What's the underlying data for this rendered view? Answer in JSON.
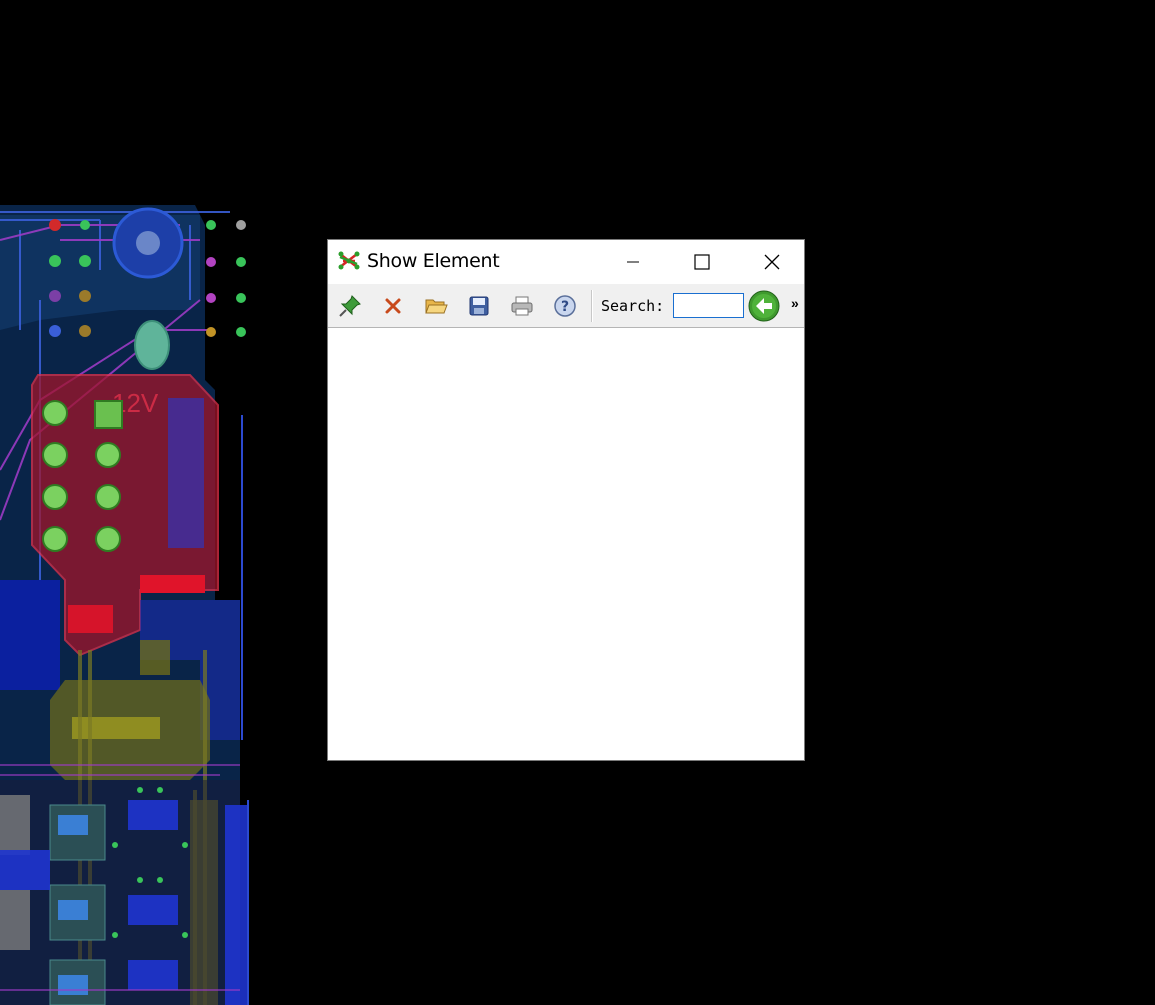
{
  "window": {
    "title": "Show Element",
    "icon": "net-graph-icon"
  },
  "window_controls": [
    "minimize-icon",
    "maximize-icon",
    "close-icon"
  ],
  "toolbar": {
    "buttons": [
      {
        "name": "pin",
        "icon": "pin-icon"
      },
      {
        "name": "clear",
        "icon": "delete-x-icon"
      },
      {
        "name": "open",
        "icon": "folder-open-icon"
      },
      {
        "name": "save",
        "icon": "floppy-disk-icon"
      },
      {
        "name": "print",
        "icon": "printer-icon"
      },
      {
        "name": "help",
        "icon": "help-icon"
      }
    ],
    "search_label": "Search:",
    "search_value": "",
    "go_icon": "arrow-left-icon",
    "overflow_label": "»"
  },
  "colors": {
    "background": "#000000",
    "search_border": "#1a6fd0",
    "go_button": "#3f9a2e"
  }
}
